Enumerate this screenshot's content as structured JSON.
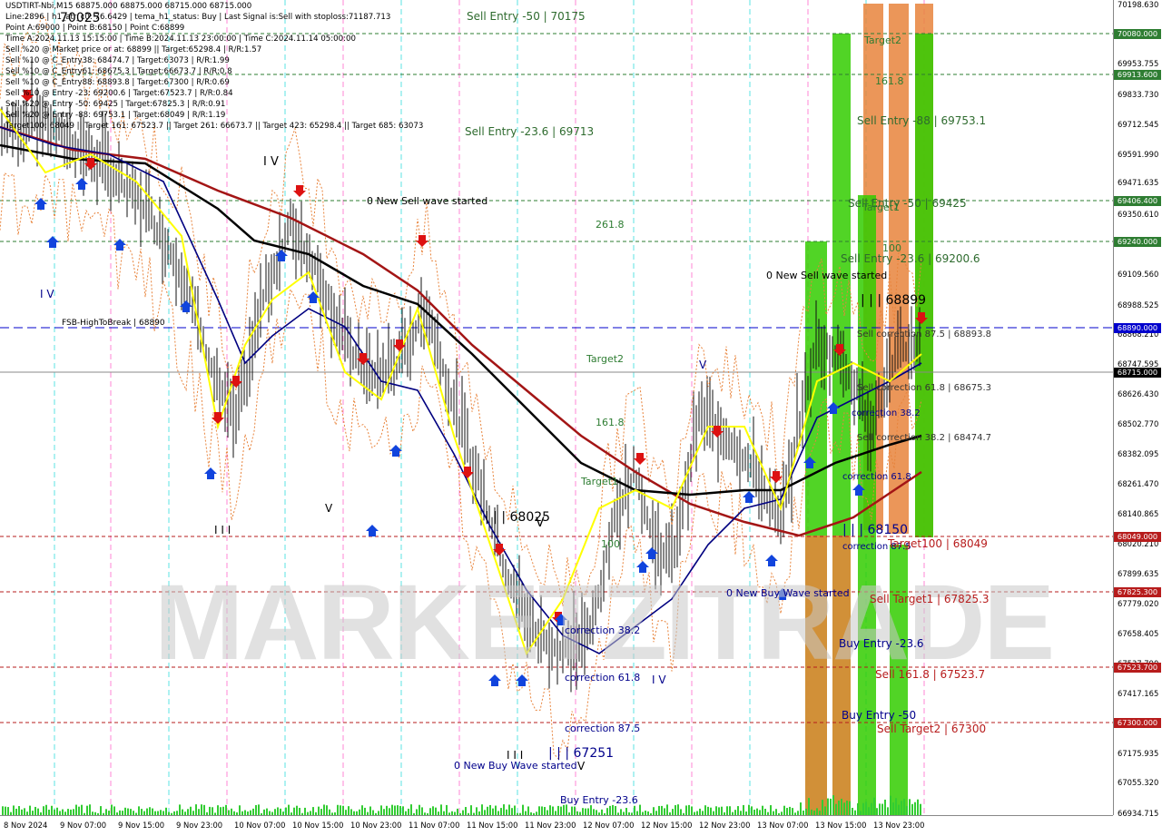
{
  "header": {
    "lines": [
      "USDTIRT-Nbi,M15  68875.000 68875.000 68715.000 68715.000",
      "Line:2896 | h1_atr_c0: 76.6429 | tema_h1_status: Buy | Last Signal is:Sell with stoploss:71187.713",
      "Point A:69000 | Point B:68150 | Point C:68899",
      "Time A:2024.11.13 15:15:00 | Time B:2024.11.13 23:00:00 | Time C:2024.11.14 05:00:00",
      "Sell %20 @ Market price or at: 68899 || Target:65298.4 | R/R:1.57",
      "Sell %10 @ C_Entry38: 68474.7 | Target:63073 | R/R:1.99",
      "Sell %10 @ C_Entry61: 68675.3 | Target:66673.7 | R/R:0.8",
      "Sell %10 @ C_Entry88: 68893.8 | Target:67300 | R/R:0.69",
      "Sell %10 @ Entry -23: 69200.6 | Target:67523.7 | R/R:0.84",
      "Sell %20 @ Entry -50: 69425 | Target:67825.3 | R/R:0.91",
      "Sell %20 @ Entry -88: 69753.1 | Target:68049 | R/R:1.19",
      "Target100: 68049 || Target 161: 67523.7 || Target 261: 66673.7 || Target 423: 65298.4 || Target 685: 63073"
    ]
  },
  "colors": {
    "green_band": "#33cc00",
    "orange_band": "#e8843c",
    "sell_text": "#8b0000",
    "buy_text": "#00008b",
    "level_line": "#2e7d32",
    "red_level": "#b71c1c",
    "navy_line": "#000080",
    "ma_red": "#a31515",
    "ma_black": "#000000",
    "yellow_line": "#ffff00"
  },
  "price_axis": {
    "ticks": [
      "70198.630",
      "70077.605",
      "69953.755",
      "69833.730",
      "69712.545",
      "69591.990",
      "69471.635",
      "69350.610",
      "69229.585",
      "69109.560",
      "68988.525",
      "68868.210",
      "68747.595",
      "68626.430",
      "68502.770",
      "68382.095",
      "68261.470",
      "68140.865",
      "68020.210",
      "67899.635",
      "67779.020",
      "67658.405",
      "67537.790",
      "67417.165",
      "67296.560",
      "67175.935",
      "67055.320",
      "66934.715"
    ],
    "tags": [
      {
        "text": "70080.000",
        "color": "#2e7d32"
      },
      {
        "text": "69913.600",
        "color": "#2e7d32"
      },
      {
        "text": "69406.400",
        "color": "#2e7d32"
      },
      {
        "text": "69240.000",
        "color": "#2e7d32"
      },
      {
        "text": "68890.000",
        "color": "#0000cd"
      },
      {
        "text": "68715.000",
        "color": "#000000"
      },
      {
        "text": "68049.000",
        "color": "#b71c1c"
      },
      {
        "text": "67825.300",
        "color": "#b71c1c"
      },
      {
        "text": "67523.700",
        "color": "#b71c1c"
      },
      {
        "text": "67300.000",
        "color": "#b71c1c"
      }
    ]
  },
  "time_axis": {
    "labels": [
      "8 Nov 2024",
      "9 Nov 07:00",
      "9 Nov 15:00",
      "9 Nov 23:00",
      "10 Nov 07:00",
      "10 Nov 15:00",
      "10 Nov 23:00",
      "11 Nov 07:00",
      "11 Nov 15:00",
      "11 Nov 23:00",
      "12 Nov 07:00",
      "12 Nov 15:00",
      "12 Nov 23:00",
      "13 Nov 07:00",
      "13 Nov 15:00",
      "13 Nov 23:00"
    ]
  },
  "annotations": {
    "sell_entry_50_top": "Sell Entry -50 | 70175",
    "sell_entry_23_top": "Sell Entry -23.6 | 69713",
    "new_sell_wave_1": "0 New Sell wave started",
    "level_261": "261.8",
    "fsb": "FSB-HighToBreak | 68890",
    "target2_mid": "Target2",
    "level_161": "161.8",
    "target1_mid": "Target1",
    "level_100": "100",
    "wave_68025": "| | | 68025",
    "wave_v1": "V",
    "wave_iv_top": "I V",
    "wave_iv_left": "I V",
    "wave_v_left": "V",
    "wave_iii_left": "I I I",
    "wave_70025": "70025",
    "corr_382_mid": "correction 38.2",
    "corr_618_mid": "correction 61.8",
    "corr_875_mid": "correction 87.5",
    "new_buy_wave_bottom": "0 New Buy Wave started",
    "wave_67251": "| | | 67251",
    "wave_iii_bottom": "I I I",
    "wave_v_bottom": "V",
    "buy_entry_23_bottom": "Buy Entry -23.6",
    "wave_iv_mid": "I V",
    "wave_v_mid": "V",
    "target2_right": "Target2",
    "level_1618_right": "161.8",
    "sell_entry_88_right": "Sell Entry -88 | 69753.1",
    "sell_entry_50_right": "Sell Entry -50 | 69425",
    "target1_right": "Target1",
    "level_100_right": "100",
    "sell_entry_236_right": "Sell Entry -23.6 | 69200.6",
    "new_sell_wave_2": "0 New Sell wave started",
    "wave_68899": "| | | 68899",
    "sell_corr_875": "Sell correction 87.5 | 68893.8",
    "sell_corr_618": "Sell correction 61.8 | 68675.3",
    "corr_382_right": "correction 38.2",
    "sell_corr_382": "Sell correction 38.2 | 68474.7",
    "corr_618_right": "correction 61.8",
    "wave_68150": "| | | 68150",
    "corr_875_right": "correction 87.5",
    "target100_right": "Target100 | 68049",
    "new_buy_wave_right": "0 New Buy Wave started",
    "sell_target1": "Sell Target1 | 67825.3",
    "buy_entry_236_right": "Buy Entry -23.6",
    "sell_1618": "Sell 161.8 | 67523.7",
    "buy_entry_50_right": "Buy Entry -50",
    "sell_target2": "Sell Target2 | 67300"
  },
  "watermark": "MARKETZITRADE"
}
